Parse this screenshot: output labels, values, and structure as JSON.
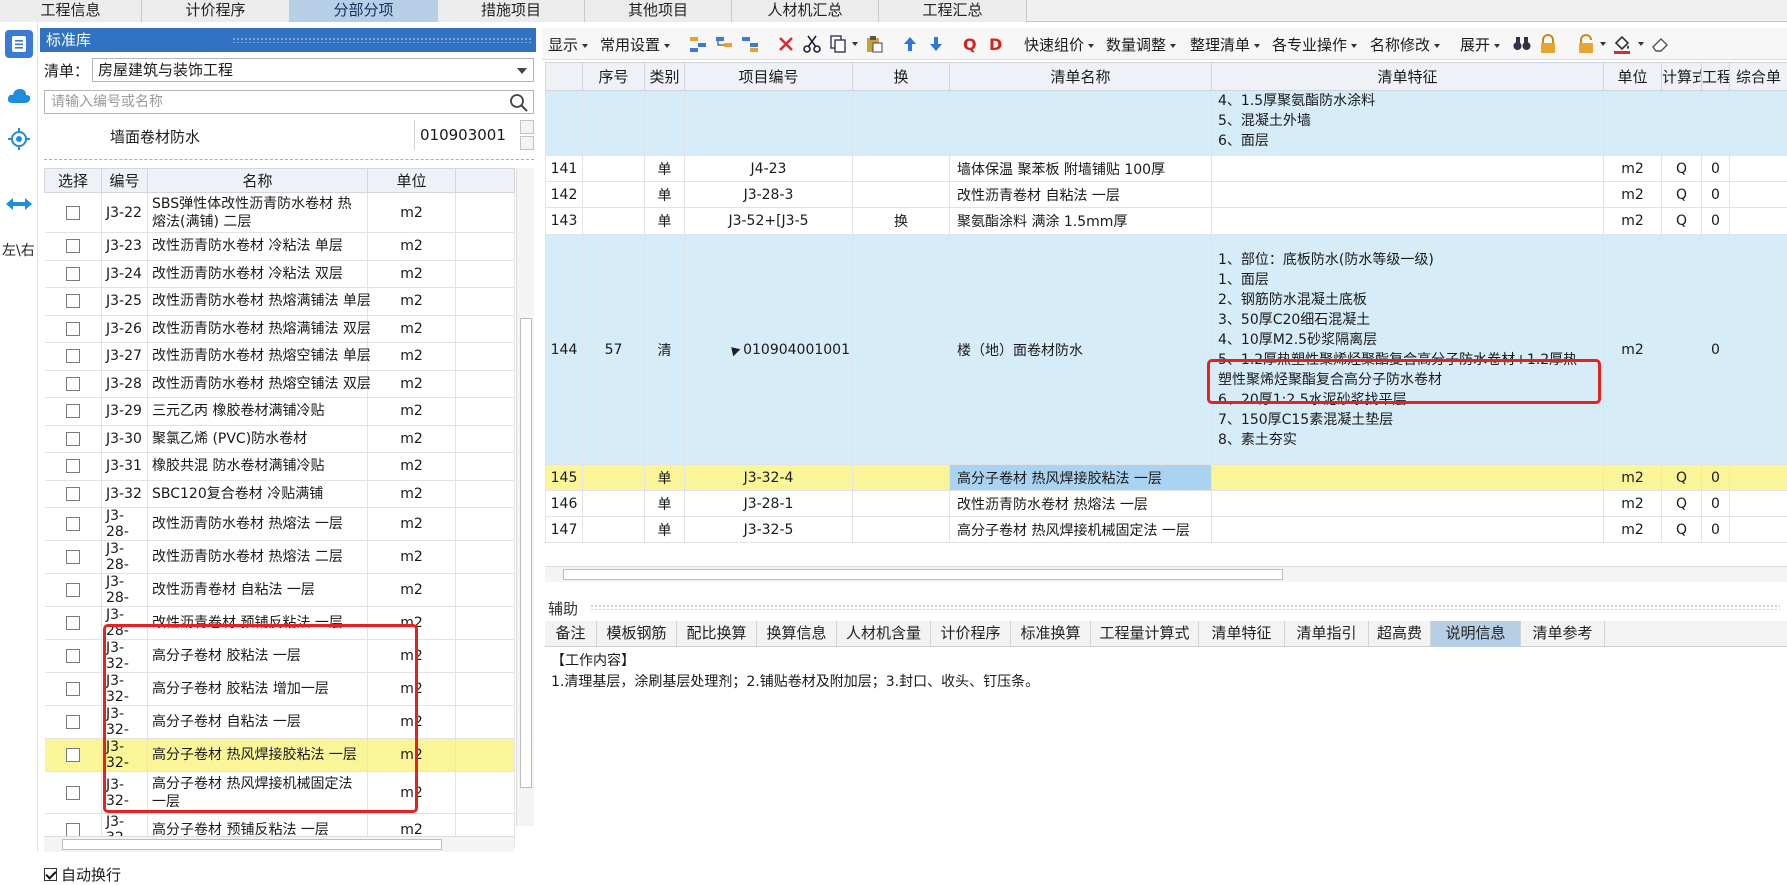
{
  "top_tabs": [
    "工程信息",
    "计价程序",
    "分部分项",
    "措施项目",
    "其他项目",
    "人材机汇总",
    "工程汇总"
  ],
  "rail": {
    "left_right_label": "左\\右"
  },
  "library": {
    "header": "标准库",
    "list_label": "清单：",
    "list_value": "房屋建筑与装饰工程",
    "search_placeholder": "请输入编号或名称",
    "category_name": "墙面卷材防水",
    "category_code": "010903001",
    "columns": [
      "选择",
      "编号",
      "名称",
      "单位",
      ""
    ],
    "rows": [
      {
        "code": "J3-22",
        "name": "SBS弹性体改性沥青防水卷材 热熔法(满铺) 二层",
        "unit": "m2"
      },
      {
        "code": "J3-23",
        "name": "改性沥青防水卷材 冷粘法 单层",
        "unit": "m2"
      },
      {
        "code": "J3-24",
        "name": "改性沥青防水卷材 冷粘法 双层",
        "unit": "m2"
      },
      {
        "code": "J3-25",
        "name": "改性沥青防水卷材 热熔满铺法 单层",
        "unit": "m2"
      },
      {
        "code": "J3-26",
        "name": "改性沥青防水卷材 热熔满铺法 双层",
        "unit": "m2"
      },
      {
        "code": "J3-27",
        "name": "改性沥青防水卷材 热熔空铺法 单层",
        "unit": "m2"
      },
      {
        "code": "J3-28",
        "name": "改性沥青防水卷材 热熔空铺法 双层",
        "unit": "m2"
      },
      {
        "code": "J3-29",
        "name": "三元乙丙 橡胶卷材满铺冷贴",
        "unit": "m2"
      },
      {
        "code": "J3-30",
        "name": "聚氯乙烯 (PVC)防水卷材",
        "unit": "m2"
      },
      {
        "code": "J3-31",
        "name": "橡胶共混 防水卷材满铺冷贴",
        "unit": "m2"
      },
      {
        "code": "J3-32",
        "name": "SBC120复合卷材 冷贴满铺",
        "unit": "m2"
      },
      {
        "code": "J3-28-",
        "name": "改性沥青防水卷材 热熔法 一层",
        "unit": "m2"
      },
      {
        "code": "J3-28-",
        "name": "改性沥青防水卷材 热熔法 二层",
        "unit": "m2"
      },
      {
        "code": "J3-28-",
        "name": "改性沥青卷材 自粘法 一层",
        "unit": "m2"
      },
      {
        "code": "J3-28-",
        "name": "改性沥青卷材 预铺反粘法 一层",
        "unit": "m2"
      },
      {
        "code": "J3-32-",
        "name": "高分子卷材 胶粘法 一层",
        "unit": "m2"
      },
      {
        "code": "J3-32-",
        "name": "高分子卷材 胶粘法 增加一层",
        "unit": "m2"
      },
      {
        "code": "J3-32-",
        "name": "高分子卷材 自粘法 一层",
        "unit": "m2"
      },
      {
        "code": "J3-32-",
        "name": "高分子卷材 热风焊接胶粘法 一层",
        "unit": "m2"
      },
      {
        "code": "J3-32-",
        "name": "高分子卷材 热风焊接机械固定法 一层",
        "unit": "m2"
      },
      {
        "code": "J3-32-",
        "name": "高分子卷材 预铺反粘法 一层",
        "unit": "m2"
      }
    ],
    "auto_wrap": "自动换行"
  },
  "toolbar": {
    "display": "显示",
    "common": "常用设置",
    "quick_price": "快速组价",
    "qty_adjust": "数量调整",
    "organize": "整理清单",
    "specialty": "各专业操作",
    "rename": "名称修改",
    "expand": "展开"
  },
  "main_table": {
    "columns": [
      "序号",
      "类别",
      "项目编号",
      "换",
      "清单名称",
      "清单特征",
      "单位",
      "计算式",
      "工程",
      "综合单"
    ],
    "top_features": [
      "4、1.5厚聚氨酯防水涂料",
      "5、混凝土外墙",
      "6、面层"
    ],
    "rows": [
      {
        "no": "141",
        "seq": "",
        "type": "单",
        "code": "J4-23",
        "swap": "",
        "name": "墙体保温 聚苯板 附墙铺贴 100厚",
        "unit": "m2",
        "calc": "Q",
        "qty": "0"
      },
      {
        "no": "142",
        "seq": "",
        "type": "单",
        "code": "J3-28-3",
        "swap": "",
        "name": "改性沥青卷材 自粘法 一层",
        "unit": "m2",
        "calc": "Q",
        "qty": "0"
      },
      {
        "no": "143",
        "seq": "",
        "type": "单",
        "code": "J3-52+[J3-5",
        "swap": "换",
        "name": "聚氨酯涂料 满涂 1.5mm厚",
        "unit": "m2",
        "calc": "Q",
        "qty": "0"
      },
      {
        "no": "144",
        "seq": "57",
        "type": "清",
        "code": "010904001001",
        "swap": "",
        "name": "楼（地）面卷材防水",
        "unit": "m2",
        "calc": "",
        "qty": "0"
      },
      {
        "no": "145",
        "seq": "",
        "type": "单",
        "code": "J3-32-4",
        "swap": "",
        "name": "高分子卷材 热风焊接胶粘法 一层",
        "unit": "m2",
        "calc": "Q",
        "qty": "0"
      },
      {
        "no": "146",
        "seq": "",
        "type": "单",
        "code": "J3-28-1",
        "swap": "",
        "name": "改性沥青防水卷材 热熔法 一层",
        "unit": "m2",
        "calc": "Q",
        "qty": "0"
      },
      {
        "no": "147",
        "seq": "",
        "type": "单",
        "code": "J3-32-5",
        "swap": "",
        "name": "高分子卷材 热风焊接机械固定法 一层",
        "unit": "m2",
        "calc": "Q",
        "qty": "0"
      }
    ],
    "row144_features": [
      "1、部位：底板防水(防水等级一级)",
      "1、面层",
      "2、钢筋防水混凝土底板",
      "3、50厚C20细石混凝土",
      "4、10厚M2.5砂浆隔离层",
      "5、1.2厚热塑性聚烯烃聚酯复合高分子防水卷材+1.2厚热",
      "塑性聚烯烃聚酯复合高分子防水卷材",
      "6、20厚1:2.5水泥砂浆找平层",
      "7、150厚C15素混凝土垫层",
      "8、素土夯实"
    ]
  },
  "aux": {
    "label": "辅助",
    "tabs": [
      "备注",
      "模板钢筋",
      "配比换算",
      "换算信息",
      "人材机含量",
      "计价程序",
      "标准换算",
      "工程量计算式",
      "清单特征",
      "清单指引",
      "超高费",
      "说明信息",
      "清单参考"
    ],
    "active_tab": "说明信息",
    "content_title": "【工作内容】",
    "content_body": "1.清理基层，涂刷基层处理剂；2.铺贴卷材及附加层；3.封口、收头、钉压条。"
  },
  "colors": {
    "accent_blue": "#3172c2",
    "highlight_yellow": "#fbf59a",
    "row_blue": "#d7ecf9",
    "red_box": "#e52222",
    "active_tab": "#b7cfe6"
  }
}
